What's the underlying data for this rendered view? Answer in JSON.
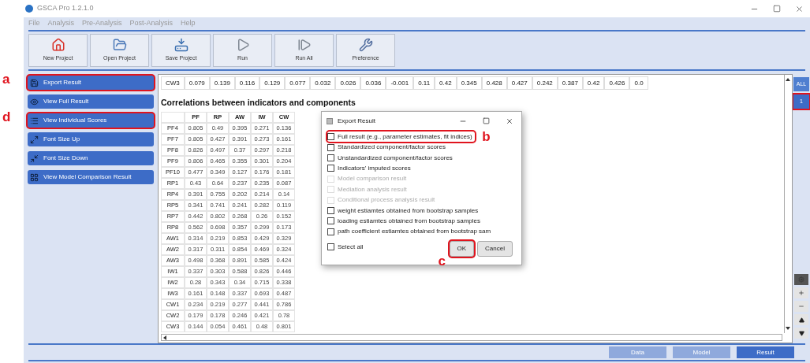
{
  "window": {
    "title": "GSCA Pro 1.2.1.0"
  },
  "menu": [
    "File",
    "Analysis",
    "Pre-Analysis",
    "Post-Analysis",
    "Help"
  ],
  "toolbar": [
    {
      "label": "New Project",
      "kind": "house"
    },
    {
      "label": "Open Project",
      "kind": "folder"
    },
    {
      "label": "Save Project",
      "kind": "drive"
    },
    {
      "label": "Run",
      "kind": "play"
    },
    {
      "label": "Run All",
      "kind": "step"
    },
    {
      "label": "Preference",
      "kind": "tools"
    }
  ],
  "sidebar": [
    {
      "label": "Export Result",
      "kind": "save",
      "highlighted": true,
      "callout": "a"
    },
    {
      "label": "View Full Result",
      "kind": "eye",
      "highlighted": false
    },
    {
      "label": "View Individual Scores",
      "kind": "list",
      "highlighted": true,
      "callout": "d"
    },
    {
      "label": "Font Size Up",
      "kind": "grow",
      "highlighted": false
    },
    {
      "label": "Font Size Down",
      "kind": "shrink",
      "highlighted": false
    },
    {
      "label": "View Model Comparison Result",
      "kind": "grid",
      "highlighted": false
    }
  ],
  "top_row": [
    "CW3",
    "0.079",
    "0.139",
    "0.116",
    "0.129",
    "0.077",
    "0.032",
    "0.026",
    "0.036",
    "-0.001",
    "0.11",
    "0.42",
    "0.345",
    "0.428",
    "0.427",
    "0.242",
    "0.387",
    "0.42",
    "0.426",
    "0.0"
  ],
  "section_title": "Correlations between indicators and components",
  "table": {
    "columns": [
      "PF",
      "RP",
      "AW",
      "IW",
      "CW"
    ],
    "rows": [
      {
        "label": "PF4",
        "values": [
          "0.805",
          "0.49",
          "0.395",
          "0.271",
          "0.136"
        ]
      },
      {
        "label": "PF7",
        "values": [
          "0.805",
          "0.427",
          "0.391",
          "0.273",
          "0.161"
        ]
      },
      {
        "label": "PF8",
        "values": [
          "0.826",
          "0.497",
          "0.37",
          "0.297",
          "0.218"
        ]
      },
      {
        "label": "PF9",
        "values": [
          "0.806",
          "0.465",
          "0.355",
          "0.301",
          "0.204"
        ]
      },
      {
        "label": "PF10",
        "values": [
          "0.477",
          "0.349",
          "0.127",
          "0.176",
          "0.181"
        ]
      },
      {
        "label": "RP1",
        "values": [
          "0.43",
          "0.64",
          "0.237",
          "0.235",
          "0.087"
        ]
      },
      {
        "label": "RP4",
        "values": [
          "0.391",
          "0.755",
          "0.202",
          "0.214",
          "0.14"
        ]
      },
      {
        "label": "RP5",
        "values": [
          "0.341",
          "0.741",
          "0.241",
          "0.282",
          "0.119"
        ]
      },
      {
        "label": "RP7",
        "values": [
          "0.442",
          "0.802",
          "0.268",
          "0.26",
          "0.152"
        ]
      },
      {
        "label": "RP8",
        "values": [
          "0.562",
          "0.698",
          "0.357",
          "0.299",
          "0.173"
        ]
      },
      {
        "label": "AW1",
        "values": [
          "0.314",
          "0.219",
          "0.853",
          "0.429",
          "0.329"
        ]
      },
      {
        "label": "AW2",
        "values": [
          "0.317",
          "0.311",
          "0.854",
          "0.469",
          "0.324"
        ]
      },
      {
        "label": "AW3",
        "values": [
          "0.498",
          "0.368",
          "0.891",
          "0.585",
          "0.424"
        ]
      },
      {
        "label": "IW1",
        "values": [
          "0.337",
          "0.303",
          "0.588",
          "0.826",
          "0.446"
        ]
      },
      {
        "label": "IW2",
        "values": [
          "0.28",
          "0.343",
          "0.34",
          "0.715",
          "0.338"
        ]
      },
      {
        "label": "IW3",
        "values": [
          "0.161",
          "0.148",
          "0.337",
          "0.693",
          "0.487"
        ]
      },
      {
        "label": "CW1",
        "values": [
          "0.234",
          "0.219",
          "0.277",
          "0.441",
          "0.786"
        ]
      },
      {
        "label": "CW2",
        "values": [
          "0.179",
          "0.178",
          "0.246",
          "0.421",
          "0.78"
        ]
      },
      {
        "label": "CW3",
        "values": [
          "0.144",
          "0.054",
          "0.461",
          "0.48",
          "0.801"
        ]
      }
    ]
  },
  "dialog": {
    "title": "Export Result",
    "options": [
      {
        "label": "Full result (e.g., parameter estimates, fit indices)",
        "checked": false,
        "disabled": false,
        "highlighted": true,
        "callout": "b"
      },
      {
        "label": "Standardized component/factor scores",
        "checked": false,
        "disabled": false,
        "highlighted": false
      },
      {
        "label": "Unstandardized component/factor scores",
        "checked": false,
        "disabled": false,
        "highlighted": false
      },
      {
        "label": "Indicators' imputed scores",
        "checked": false,
        "disabled": false,
        "highlighted": false
      },
      {
        "label": "Model comparison result",
        "checked": false,
        "disabled": true,
        "highlighted": false
      },
      {
        "label": "Mediation analysis result",
        "checked": false,
        "disabled": true,
        "highlighted": false
      },
      {
        "label": "Conditional process analysis result",
        "checked": false,
        "disabled": true,
        "highlighted": false
      },
      {
        "label": "weight estiamtes obtained from bootstrap samples",
        "checked": false,
        "disabled": false,
        "highlighted": false
      },
      {
        "label": "loading estiamtes obtained from bootstrap samples",
        "checked": false,
        "disabled": false,
        "highlighted": false
      },
      {
        "label": "path coefficient estiamtes obtained from bootstrap sam",
        "checked": false,
        "disabled": false,
        "highlighted": false
      }
    ],
    "select_all": {
      "label": "Select all",
      "checked": false
    },
    "buttons": [
      {
        "label": "OK",
        "highlighted": true,
        "callout": "c"
      },
      {
        "label": "Cancel",
        "highlighted": false
      }
    ]
  },
  "right_panel": [
    {
      "label": "ALL",
      "selected": false,
      "highlighted": false
    },
    {
      "label": "1",
      "selected": true,
      "highlighted": true
    }
  ],
  "bottom_tabs": [
    {
      "label": "Data",
      "selected": false
    },
    {
      "label": "Model",
      "selected": false
    },
    {
      "label": "Result",
      "selected": true
    }
  ]
}
